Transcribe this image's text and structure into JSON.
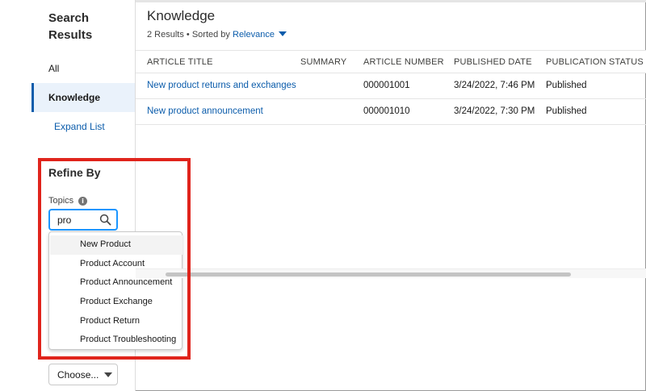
{
  "sidebar": {
    "title": "Search Results",
    "all_label": "All",
    "knowledge_label": "Knowledge",
    "expand_label": "Expand List",
    "refine_title": "Refine By",
    "topics_label": "Topics",
    "topic_search": {
      "value": "pro",
      "placeholder": ""
    },
    "topic_suggestions": [
      "New Product",
      "Product Account",
      "Product Announcement",
      "Product Exchange",
      "Product Return",
      "Product Troubleshooting"
    ],
    "choose_label": "Choose..."
  },
  "main": {
    "title": "Knowledge",
    "result_count": "2 Results",
    "sorted_by_label": "Sorted by",
    "sort_value": "Relevance",
    "columns": [
      "ARTICLE TITLE",
      "SUMMARY",
      "ARTICLE NUMBER",
      "PUBLISHED DATE",
      "PUBLICATION STATUS"
    ],
    "rows": [
      {
        "title": "New product returns and exchanges",
        "summary": "",
        "number": "000001001",
        "date": "3/24/2022, 7:46 PM",
        "status": "Published"
      },
      {
        "title": "New product announcement",
        "summary": "",
        "number": "000001010",
        "date": "3/24/2022, 7:30 PM",
        "status": "Published"
      }
    ]
  },
  "icons": {
    "info": "info-icon",
    "search": "search-icon",
    "sort": "chevron-down-icon",
    "select": "chevron-down-icon"
  },
  "colors": {
    "link": "#0b5cab",
    "selected_bg": "#eaf2fb",
    "focus_border": "#1b96ff",
    "highlight": "#e0241c"
  }
}
